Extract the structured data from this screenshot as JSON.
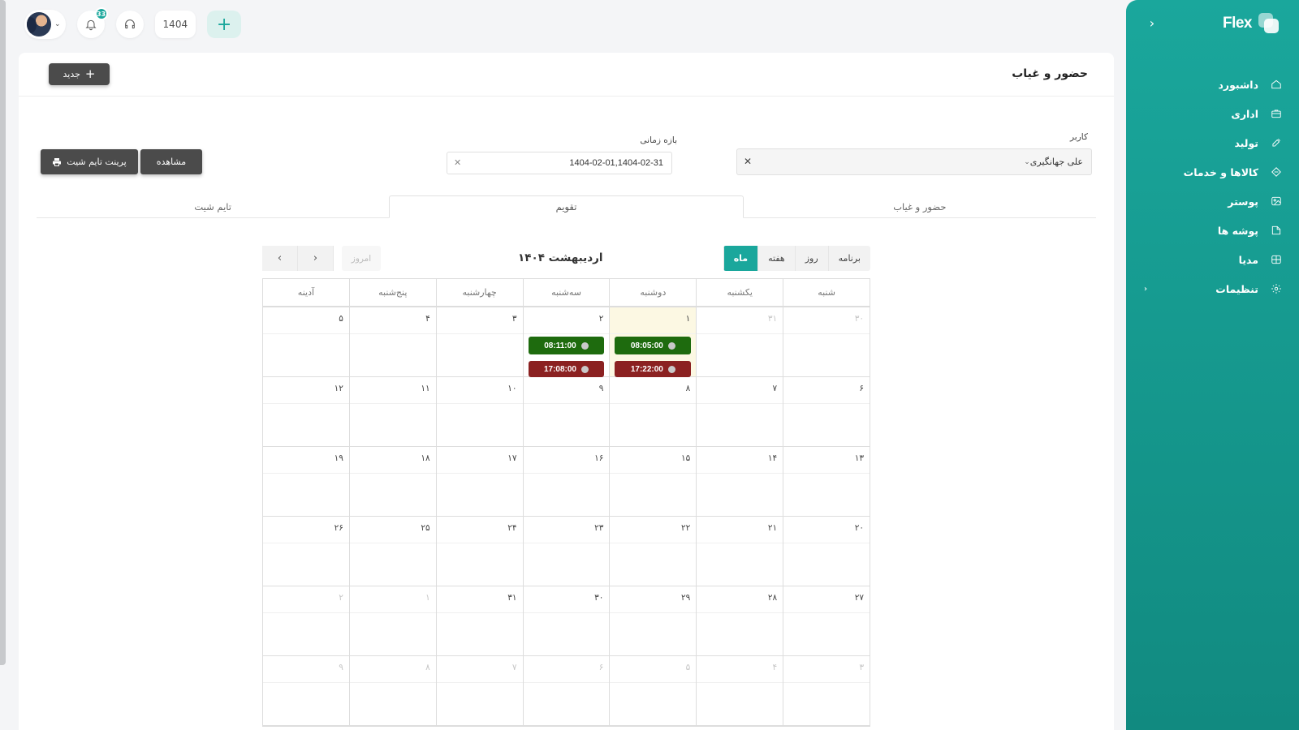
{
  "app": {
    "brand": "Flex"
  },
  "topbar": {
    "notifications_count": "33",
    "year": "1404"
  },
  "sidebar": {
    "items": [
      {
        "label": "داشبورد",
        "icon": "home-icon"
      },
      {
        "label": "اداری",
        "icon": "briefcase-icon"
      },
      {
        "label": "تولید",
        "icon": "tools-icon"
      },
      {
        "label": "کالاها و خدمات",
        "icon": "box-icon"
      },
      {
        "label": "پوستر",
        "icon": "image-icon"
      },
      {
        "label": "پوشه ها",
        "icon": "folder-icon"
      },
      {
        "label": "مدیا",
        "icon": "media-icon"
      },
      {
        "label": "تنظیمات",
        "icon": "gear-icon"
      }
    ]
  },
  "page": {
    "title": "حضور و غیاب",
    "new_label": "جدید"
  },
  "filters": {
    "user_label": "کاربر",
    "user_value": "علی جهانگیری",
    "range_label": "بازه زمانی",
    "range_value": "1404-02-01,1404-02-31",
    "view_label": "مشاهده",
    "print_label": "پرینت تایم شیت"
  },
  "tabs": [
    "حضور و غیاب",
    "تقویم",
    "تایم شیت"
  ],
  "calendar": {
    "views": [
      "برنامه",
      "روز",
      "هفته",
      "ماه"
    ],
    "active_view": "ماه",
    "title": "اردیبهشت ۱۴۰۴",
    "today_label": "امروز",
    "weekdays": [
      "شنبه",
      "یکشنبه",
      "دوشنبه",
      "سه‌شنبه",
      "چهارشنبه",
      "پنج‌شنبه",
      "آدینه"
    ],
    "weeks": [
      [
        {
          "d": "۳۰",
          "other": true
        },
        {
          "d": "۳۱",
          "other": true
        },
        {
          "d": "۱",
          "today": true,
          "in": "08:05:00",
          "out": "17:22:00"
        },
        {
          "d": "۲",
          "in": "08:11:00",
          "out": "17:08:00"
        },
        {
          "d": "۳"
        },
        {
          "d": "۴"
        },
        {
          "d": "۵"
        }
      ],
      [
        {
          "d": "۶"
        },
        {
          "d": "۷"
        },
        {
          "d": "۸"
        },
        {
          "d": "۹"
        },
        {
          "d": "۱۰"
        },
        {
          "d": "۱۱"
        },
        {
          "d": "۱۲"
        }
      ],
      [
        {
          "d": "۱۳"
        },
        {
          "d": "۱۴"
        },
        {
          "d": "۱۵"
        },
        {
          "d": "۱۶"
        },
        {
          "d": "۱۷"
        },
        {
          "d": "۱۸"
        },
        {
          "d": "۱۹"
        }
      ],
      [
        {
          "d": "۲۰"
        },
        {
          "d": "۲۱"
        },
        {
          "d": "۲۲"
        },
        {
          "d": "۲۳"
        },
        {
          "d": "۲۴"
        },
        {
          "d": "۲۵"
        },
        {
          "d": "۲۶"
        }
      ],
      [
        {
          "d": "۲۷"
        },
        {
          "d": "۲۸"
        },
        {
          "d": "۲۹"
        },
        {
          "d": "۳۰"
        },
        {
          "d": "۳۱"
        },
        {
          "d": "۱",
          "other": true
        },
        {
          "d": "۲",
          "other": true
        }
      ],
      [
        {
          "d": "۳",
          "other": true
        },
        {
          "d": "۴",
          "other": true
        },
        {
          "d": "۵",
          "other": true
        },
        {
          "d": "۶",
          "other": true
        },
        {
          "d": "۷",
          "other": true
        },
        {
          "d": "۸",
          "other": true
        },
        {
          "d": "۹",
          "other": true
        }
      ]
    ]
  },
  "colors": {
    "accent": "#1aa79c",
    "check_in": "#1e6b0e",
    "check_out": "#8b2121",
    "today_bg": "#fcf8e3"
  }
}
